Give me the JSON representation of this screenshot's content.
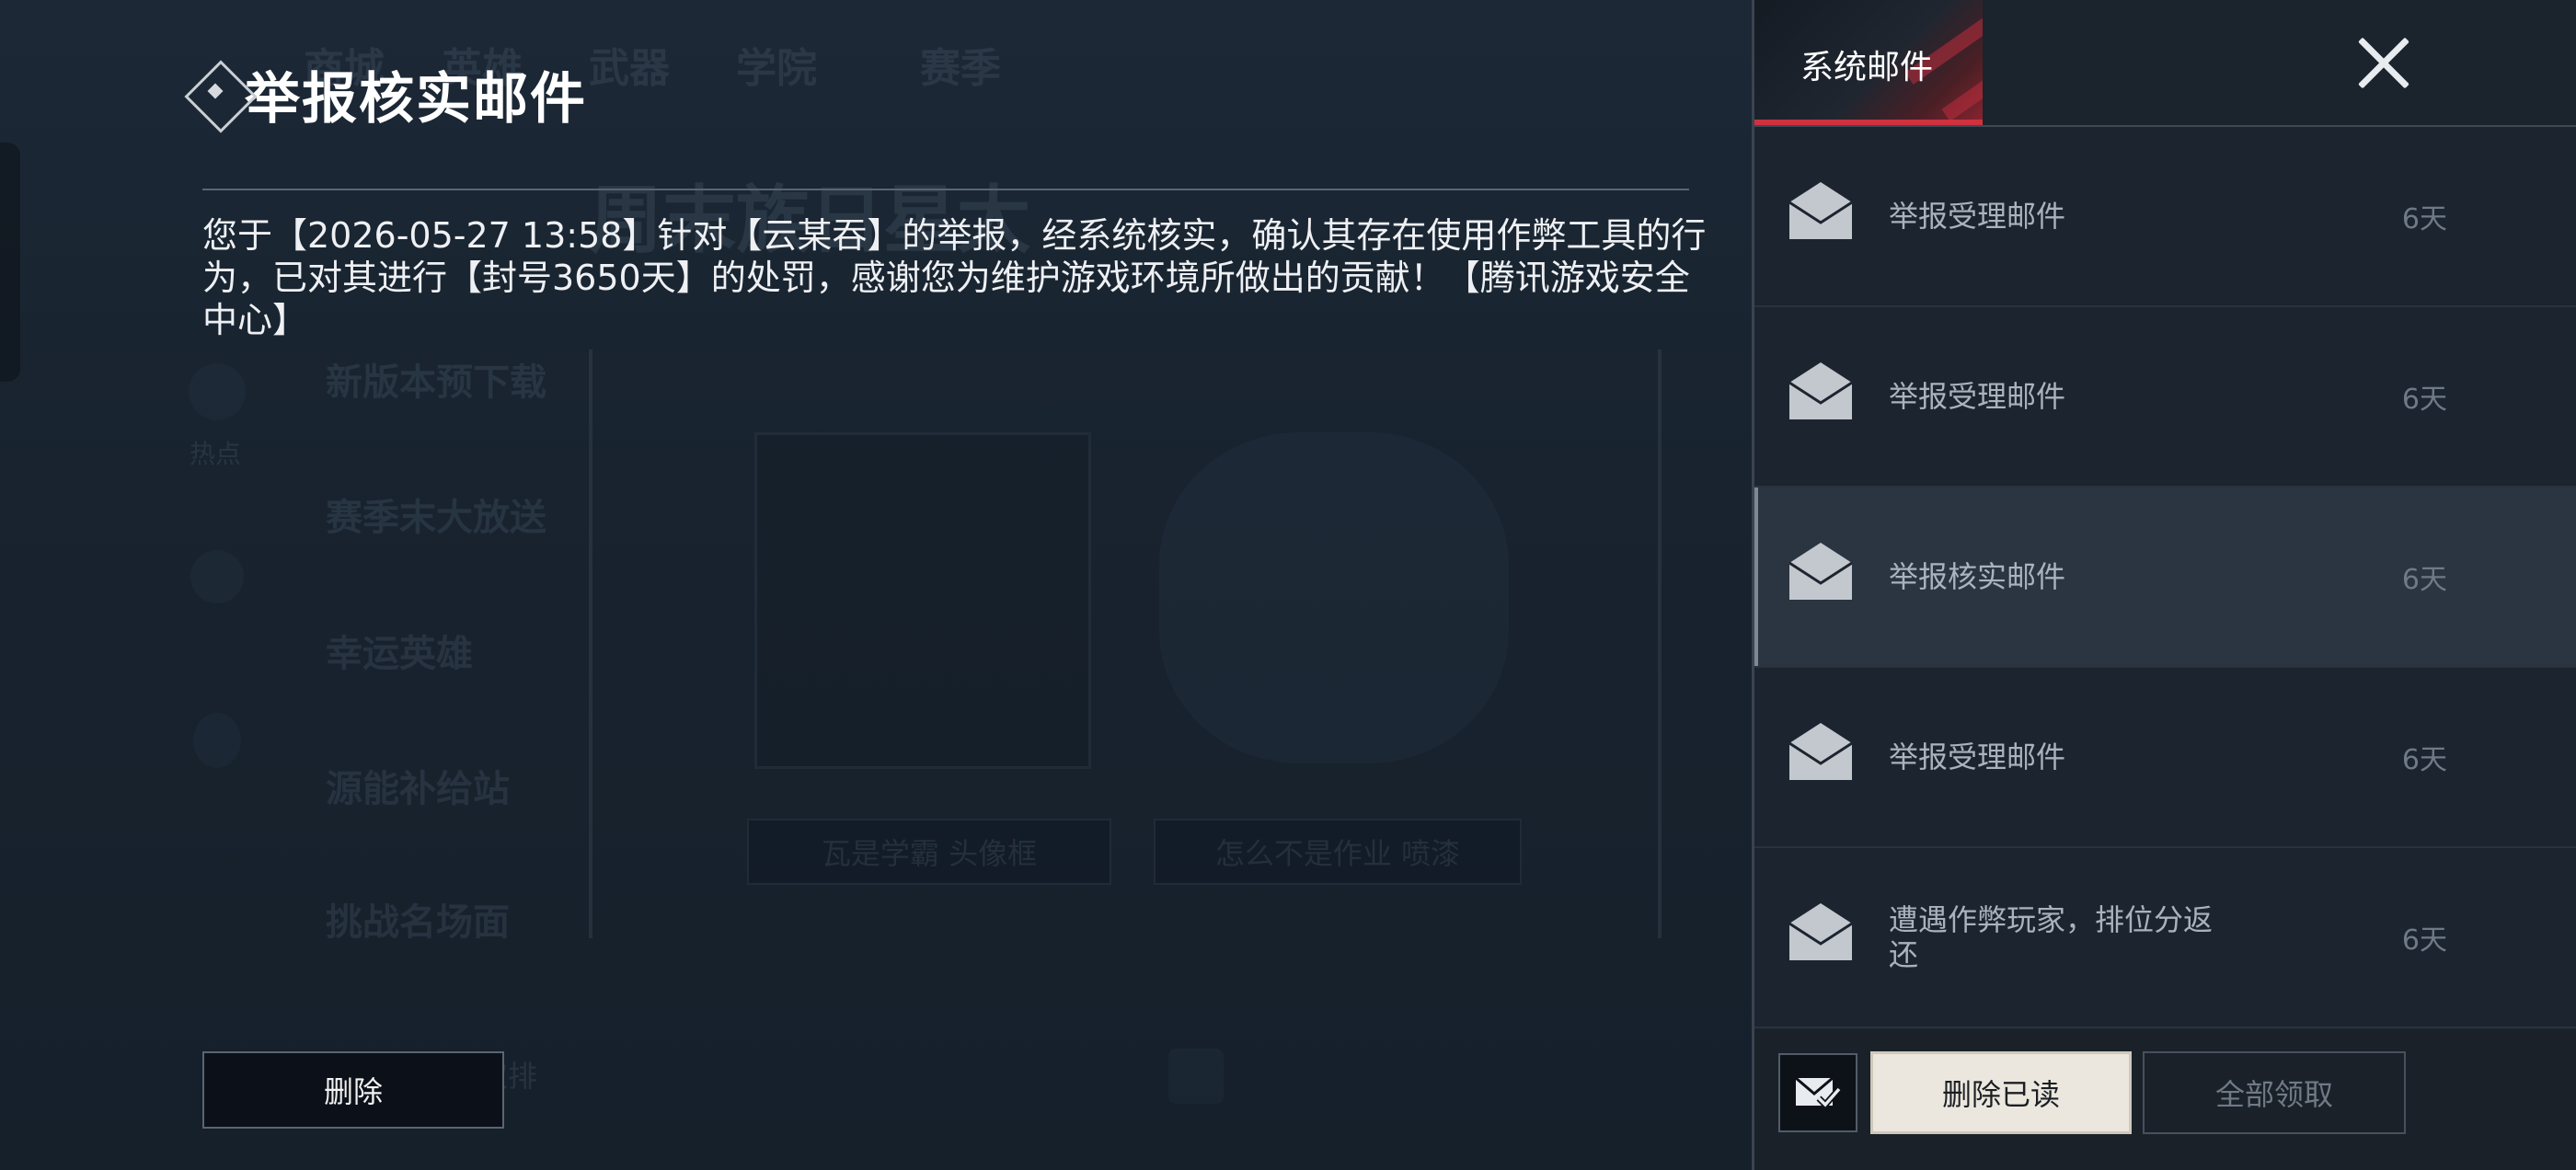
{
  "detail": {
    "title": "举报核实邮件",
    "body": "您于【2026-05-27 13:58】针对【云某吞】的举报，经系统核实，确认其存在使用作弊工具的行为，已对其进行【封号3650天】的处罚，感谢您为维护游戏环境所做出的贡献！【腾讯游戏安全中心】",
    "delete_label": "删除"
  },
  "panel": {
    "tab_label": "系统邮件",
    "close_icon": "close-icon"
  },
  "mails": [
    {
      "title": "举报受理邮件",
      "age": "6天",
      "selected": false
    },
    {
      "title": "举报受理邮件",
      "age": "6天",
      "selected": false
    },
    {
      "title": "举报核实邮件",
      "age": "6天",
      "selected": true
    },
    {
      "title": "举报受理邮件",
      "age": "6天",
      "selected": false
    },
    {
      "title": "遭遇作弊玩家，排位分返还",
      "age": "6天",
      "selected": false
    }
  ],
  "footer": {
    "mark_read_icon": "envelope-check-icon",
    "delete_read_label": "删除已读",
    "claim_all_label": "全部领取"
  },
  "background": {
    "nav": [
      "商城",
      "英雄",
      "武器",
      "学院",
      "赛季"
    ],
    "banner": "周末族日星太",
    "sidebar_icons": [
      {
        "icon": "hot-icon",
        "label": "热点"
      },
      {
        "icon": "star-icon",
        "label": ""
      },
      {
        "icon": "bulb-icon",
        "label": ""
      }
    ],
    "menu": [
      "新版本预下载",
      "赛季末大放送",
      "幸运英雄",
      "源能补给站",
      "挑战名场面"
    ],
    "cards": [
      "瓦是学霸 头像框",
      "怎么不是作业 喷漆"
    ],
    "bottom_left": "取排"
  },
  "colors": {
    "accent_red": "#d0313f",
    "selected_row": "#2b3441",
    "primary_button": "#ece7de"
  }
}
